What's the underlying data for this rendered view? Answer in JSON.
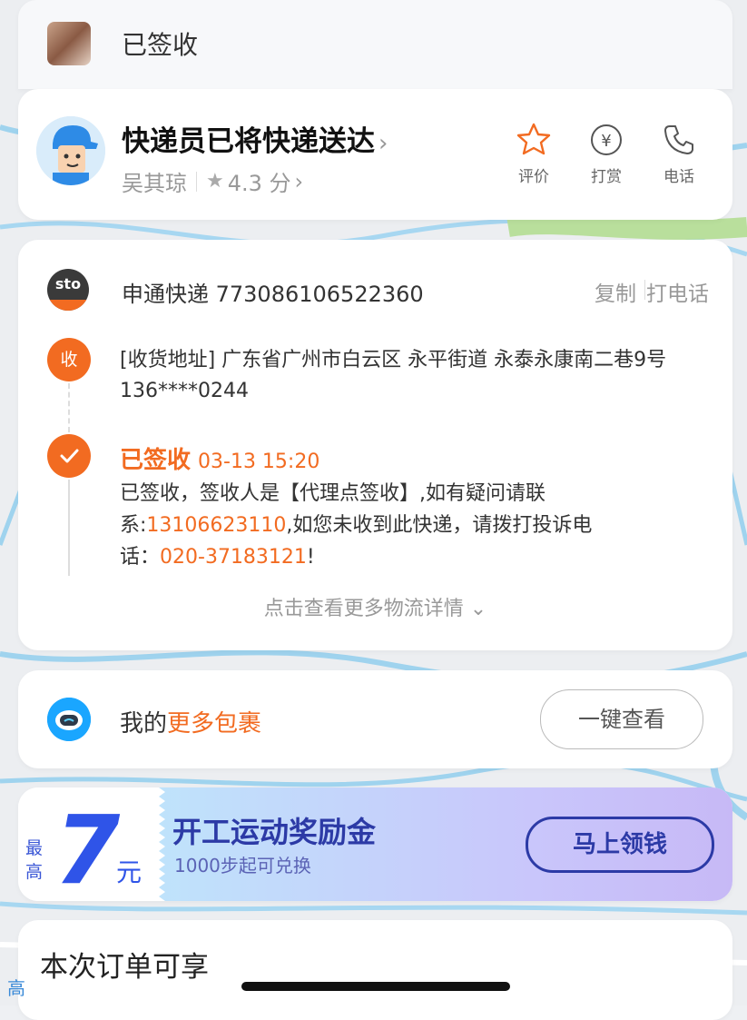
{
  "header": {
    "status_title": "已签收"
  },
  "courier": {
    "title": "快递员已将快递送达",
    "name": "吴其琼",
    "rating": "4.3 分",
    "actions": [
      {
        "label": "评价",
        "icon": "star-icon"
      },
      {
        "label": "打赏",
        "icon": "yen-icon"
      },
      {
        "label": "电话",
        "icon": "phone-icon"
      }
    ]
  },
  "shipment": {
    "carrier_logo_text": "sto",
    "tracking": "申通快递 773086106522360",
    "copy_label": "复制",
    "call_label": "打电话",
    "address_node": "收",
    "address": "[收货地址] 广东省广州市白云区  永平街道   永泰永康南二巷9号 136****0244",
    "signed_status": "已签收",
    "signed_time": "03-13 15:20",
    "signed_text_1": "已签收，签收人是【代理点签收】,如有疑问请联系:",
    "signed_phone_1": "13106623110",
    "signed_text_2": ",如您未收到此快递，请拨打投诉电话：",
    "signed_phone_2": "020-37183121",
    "signed_text_3": "!",
    "more_details": "点击查看更多物流详情"
  },
  "packages": {
    "prefix": "我的",
    "highlight": "更多包裹",
    "button": "一键查看"
  },
  "promo": {
    "max_label": "最高",
    "amount": "7",
    "unit": "元",
    "title": "开工运动奖励金",
    "subtitle": "1000步起可兑换",
    "button": "马上领钱"
  },
  "order": {
    "title": "本次订单可享"
  },
  "side_char": "高",
  "colors": {
    "accent": "#f26b21",
    "promo_blue": "#2f54e8"
  }
}
